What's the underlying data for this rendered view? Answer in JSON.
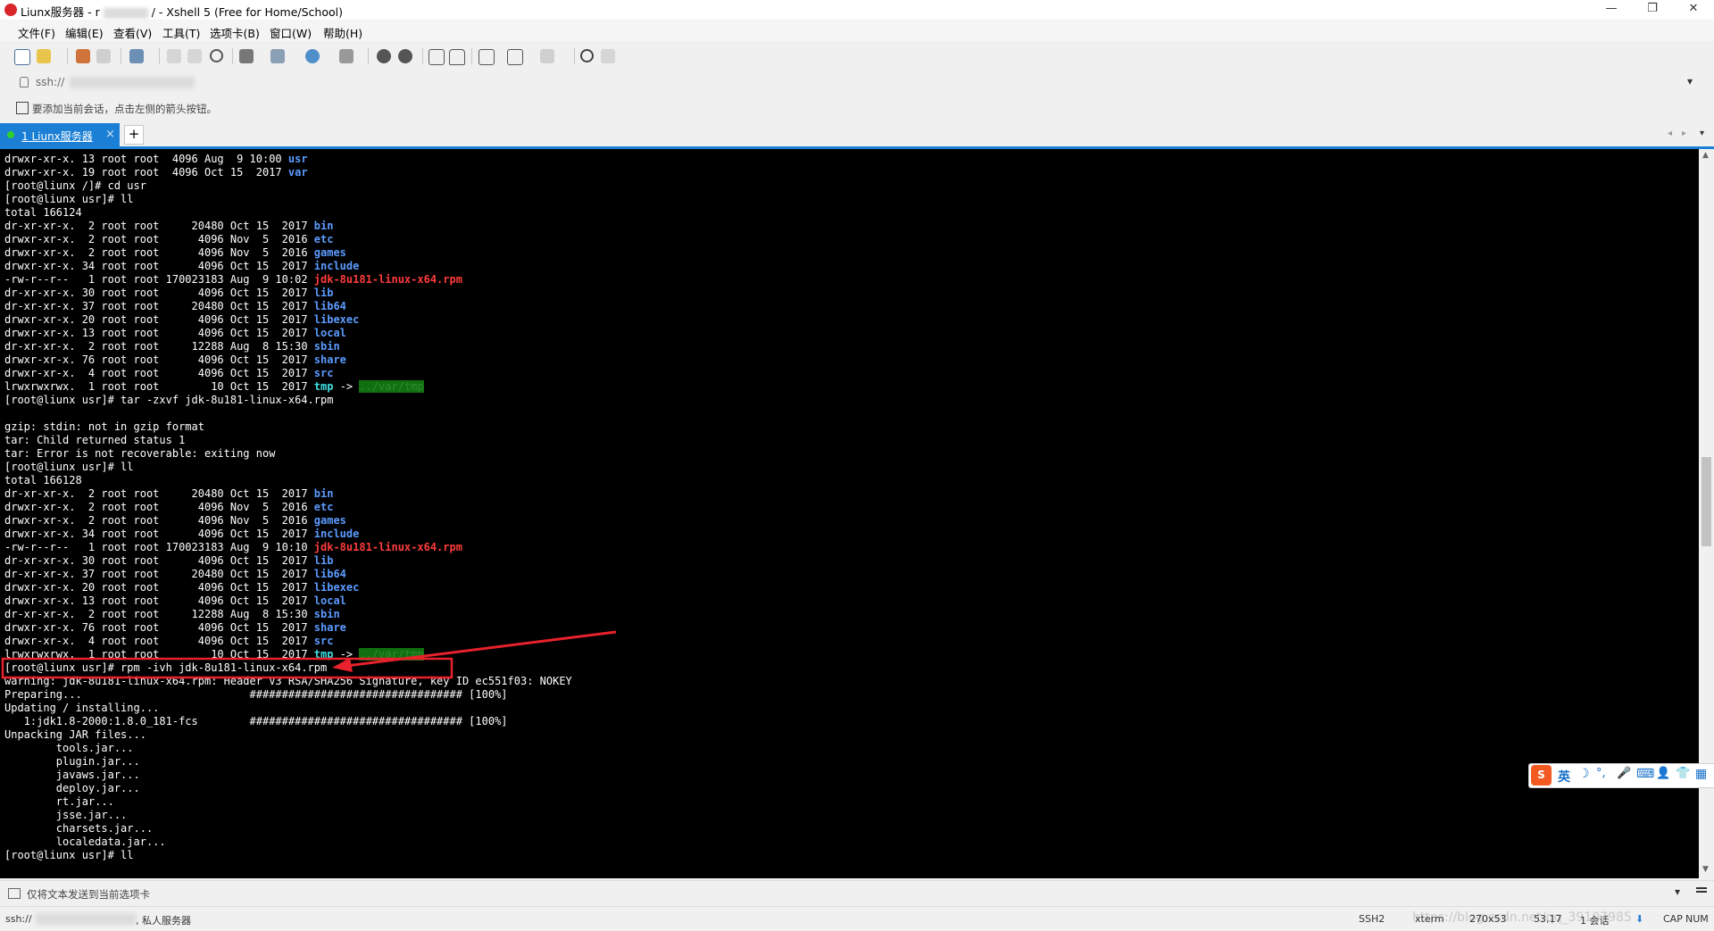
{
  "window": {
    "title_prefix": "Liunx服务器 - r",
    "title_suffix": "/ - Xshell 5 (Free for Home/School)",
    "minimize_glyph": "—",
    "maximize_glyph": "❐",
    "close_glyph": "✕"
  },
  "menu": [
    "文件(F)",
    "编辑(E)",
    "查看(V)",
    "工具(T)",
    "选项卡(B)",
    "窗口(W)",
    "帮助(H)"
  ],
  "address": {
    "prefix": "ssh://",
    "dropdown_glyph": "▾"
  },
  "hint": {
    "text": "要添加当前会话，点击左侧的箭头按钮。"
  },
  "tabs": [
    {
      "label": "1 Liunx服务器",
      "close_glyph": "×",
      "active": true
    }
  ],
  "new_tab_glyph": "+",
  "terminal": {
    "lines": [
      [
        [
          "drwxr-xr-x. 13 root root  4096 Aug  9 10:00 ",
          ""
        ],
        [
          "usr",
          "dir"
        ]
      ],
      [
        [
          "drwxr-xr-x. 19 root root  4096 Oct 15  2017 ",
          ""
        ],
        [
          "var",
          "dir"
        ]
      ],
      [
        [
          "[root@liunx /]# cd usr",
          ""
        ]
      ],
      [
        [
          "[root@liunx usr]# ll",
          ""
        ]
      ],
      [
        [
          "total 166124",
          ""
        ]
      ],
      [
        [
          "dr-xr-xr-x.  2 root root     20480 Oct 15  2017 ",
          ""
        ],
        [
          "bin",
          "dir"
        ]
      ],
      [
        [
          "drwxr-xr-x.  2 root root      4096 Nov  5  2016 ",
          ""
        ],
        [
          "etc",
          "dir"
        ]
      ],
      [
        [
          "drwxr-xr-x.  2 root root      4096 Nov  5  2016 ",
          ""
        ],
        [
          "games",
          "dir"
        ]
      ],
      [
        [
          "drwxr-xr-x. 34 root root      4096 Oct 15  2017 ",
          ""
        ],
        [
          "include",
          "dir"
        ]
      ],
      [
        [
          "-rw-r--r--   1 root root 170023183 Aug  9 10:02 ",
          ""
        ],
        [
          "jdk-8u181-linux-x64.rpm",
          "rpm"
        ]
      ],
      [
        [
          "dr-xr-xr-x. 30 root root      4096 Oct 15  2017 ",
          ""
        ],
        [
          "lib",
          "dir"
        ]
      ],
      [
        [
          "dr-xr-xr-x. 37 root root     20480 Oct 15  2017 ",
          ""
        ],
        [
          "lib64",
          "dir"
        ]
      ],
      [
        [
          "drwxr-xr-x. 20 root root      4096 Oct 15  2017 ",
          ""
        ],
        [
          "libexec",
          "dir"
        ]
      ],
      [
        [
          "drwxr-xr-x. 13 root root      4096 Oct 15  2017 ",
          ""
        ],
        [
          "local",
          "dir"
        ]
      ],
      [
        [
          "dr-xr-xr-x.  2 root root     12288 Aug  8 15:30 ",
          ""
        ],
        [
          "sbin",
          "dir"
        ]
      ],
      [
        [
          "drwxr-xr-x. 76 root root      4096 Oct 15  2017 ",
          ""
        ],
        [
          "share",
          "dir"
        ]
      ],
      [
        [
          "drwxr-xr-x.  4 root root      4096 Oct 15  2017 ",
          ""
        ],
        [
          "src",
          "dir"
        ]
      ],
      [
        [
          "lrwxrwxrwx.  1 root root        10 Oct 15  2017 ",
          ""
        ],
        [
          "tmp",
          "link"
        ],
        [
          " -> ",
          ""
        ],
        [
          "../var/tmp",
          "tmp"
        ]
      ],
      [
        [
          "[root@liunx usr]# tar -zxvf jdk-8u181-linux-x64.rpm",
          ""
        ]
      ],
      [],
      [
        [
          "gzip: stdin: not in gzip format",
          ""
        ]
      ],
      [
        [
          "tar: Child returned status 1",
          ""
        ]
      ],
      [
        [
          "tar: Error is not recoverable: exiting now",
          ""
        ]
      ],
      [
        [
          "[root@liunx usr]# ll",
          ""
        ]
      ],
      [
        [
          "total 166128",
          ""
        ]
      ],
      [
        [
          "dr-xr-xr-x.  2 root root     20480 Oct 15  2017 ",
          ""
        ],
        [
          "bin",
          "dir"
        ]
      ],
      [
        [
          "drwxr-xr-x.  2 root root      4096 Nov  5  2016 ",
          ""
        ],
        [
          "etc",
          "dir"
        ]
      ],
      [
        [
          "drwxr-xr-x.  2 root root      4096 Nov  5  2016 ",
          ""
        ],
        [
          "games",
          "dir"
        ]
      ],
      [
        [
          "drwxr-xr-x. 34 root root      4096 Oct 15  2017 ",
          ""
        ],
        [
          "include",
          "dir"
        ]
      ],
      [
        [
          "-rw-r--r--   1 root root 170023183 Aug  9 10:10 ",
          ""
        ],
        [
          "jdk-8u181-linux-x64.rpm",
          "rpm"
        ]
      ],
      [
        [
          "dr-xr-xr-x. 30 root root      4096 Oct 15  2017 ",
          ""
        ],
        [
          "lib",
          "dir"
        ]
      ],
      [
        [
          "dr-xr-xr-x. 37 root root     20480 Oct 15  2017 ",
          ""
        ],
        [
          "lib64",
          "dir"
        ]
      ],
      [
        [
          "drwxr-xr-x. 20 root root      4096 Oct 15  2017 ",
          ""
        ],
        [
          "libexec",
          "dir"
        ]
      ],
      [
        [
          "drwxr-xr-x. 13 root root      4096 Oct 15  2017 ",
          ""
        ],
        [
          "local",
          "dir"
        ]
      ],
      [
        [
          "dr-xr-xr-x.  2 root root     12288 Aug  8 15:30 ",
          ""
        ],
        [
          "sbin",
          "dir"
        ]
      ],
      [
        [
          "drwxr-xr-x. 76 root root      4096 Oct 15  2017 ",
          ""
        ],
        [
          "share",
          "dir"
        ]
      ],
      [
        [
          "drwxr-xr-x.  4 root root      4096 Oct 15  2017 ",
          ""
        ],
        [
          "src",
          "dir"
        ]
      ],
      [
        [
          "lrwxrwxrwx.  1 root root        10 Oct 15  2017 ",
          ""
        ],
        [
          "tmp",
          "link"
        ],
        [
          " -> ",
          ""
        ],
        [
          "../var/tmp",
          "tmp"
        ]
      ],
      [
        [
          "[root@liunx usr]# rpm -ivh jdk-8u181-linux-x64.rpm",
          ""
        ]
      ],
      [
        [
          "warning: jdk-8u181-linux-x64.rpm: Header V3 RSA/SHA256 Signature, key ID ec551f03: NOKEY",
          ""
        ]
      ],
      [
        [
          "Preparing...                          ################################# [100%]",
          ""
        ]
      ],
      [
        [
          "Updating / installing...",
          ""
        ]
      ],
      [
        [
          "   1:jdk1.8-2000:1.8.0_181-fcs        ################################# [100%]",
          ""
        ]
      ],
      [
        [
          "Unpacking JAR files...",
          ""
        ]
      ],
      [
        [
          "        tools.jar...",
          ""
        ]
      ],
      [
        [
          "        plugin.jar...",
          ""
        ]
      ],
      [
        [
          "        javaws.jar...",
          ""
        ]
      ],
      [
        [
          "        deploy.jar...",
          ""
        ]
      ],
      [
        [
          "        rt.jar...",
          ""
        ]
      ],
      [
        [
          "        jsse.jar...",
          ""
        ]
      ],
      [
        [
          "        charsets.jar...",
          ""
        ]
      ],
      [
        [
          "        localedata.jar...",
          ""
        ]
      ],
      [
        [
          "[root@liunx usr]# ll",
          ""
        ]
      ]
    ]
  },
  "ime": {
    "logo": "S",
    "lang": "英",
    "icons": [
      "☽",
      "°,",
      "🎤",
      "⌨",
      "👤",
      "👕",
      "▦"
    ]
  },
  "sendbar": {
    "text": "仅将文本发送到当前选项卡",
    "dropdown_glyph": "▾"
  },
  "status": {
    "session_prefix": "ssh://",
    "session_suffix": ", 私人服务器",
    "protocol": "SSH2",
    "terminal_type": "xterm",
    "size": "270x53",
    "cursor_pos": "53,17",
    "sessions": "1 会话",
    "caps": "CAP",
    "num": "NUM",
    "watermark": "https://blog.csdn.net/qq_39107985"
  },
  "colors": {
    "accent": "#1b7fd5",
    "terminal_bg": "#000000",
    "dir": "#5c9bff",
    "rpm": "#ff3b3b",
    "annotation": "#e8212c"
  }
}
